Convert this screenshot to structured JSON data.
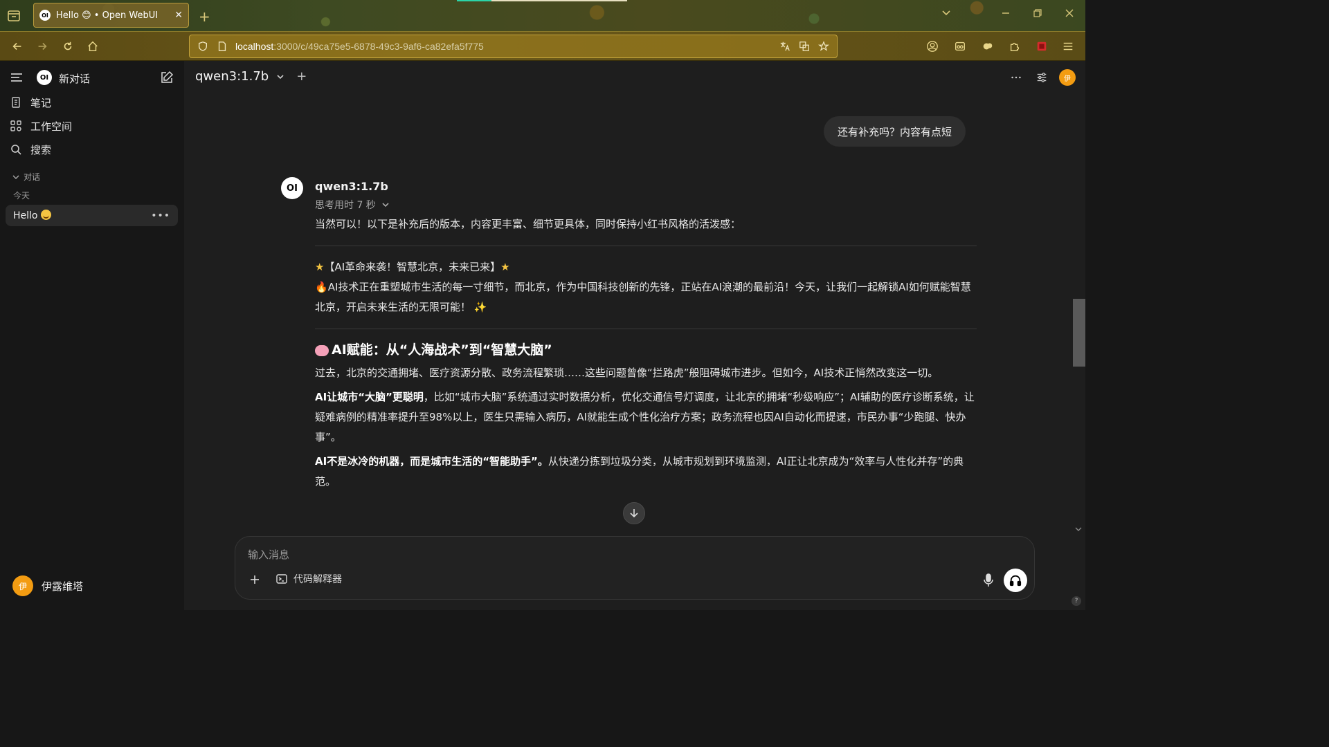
{
  "browser": {
    "tab_title": "Hello 😊 • Open WebUI",
    "tab_close": "✕",
    "new_tab": "+",
    "url_host": "localhost",
    "url_path": ":3000/c/49ca75e5-6878-49c3-9af6-ca82efa5f775"
  },
  "sidebar": {
    "new_chat_label": "新对话",
    "nav": [
      {
        "label": "笔记",
        "icon": "notes-icon"
      },
      {
        "label": "工作空间",
        "icon": "workspace-icon"
      },
      {
        "label": "搜索",
        "icon": "search-icon"
      }
    ],
    "section_label": "对话",
    "group_label": "今天",
    "chats": [
      {
        "title": "Hello",
        "more": "•••"
      }
    ],
    "user": {
      "name": "伊露维塔",
      "avatar_initial": "伊"
    }
  },
  "header": {
    "model": "qwen3:1.7b",
    "add": "+",
    "avatar_initial": "伊"
  },
  "conversation": {
    "user_message": "还有补充吗？内容有点短",
    "assistant": {
      "name": "qwen3:1.7b",
      "thinking": "思考用时 7 秒",
      "intro": "当然可以！以下是补充后的版本，内容更丰富、细节更具体，同时保持小红书风格的活泼感：",
      "banner": "【AI革命来袭！智慧北京，未来已来】",
      "lead": "AI技术正在重塑城市生活的每一寸细节，而北京，作为中国科技创新的先锋，正站在AI浪潮的最前沿！今天，让我们一起解锁AI如何赋能智慧北京，开启未来生活的无限可能！",
      "section_title": "AI赋能：从“人海战术”到“智慧大脑”",
      "para1": "过去，北京的交通拥堵、医疗资源分散、政务流程繁琐……这些问题曾像“拦路虎”般阻碍城市进步。但如今，AI技术正悄然改变这一切。",
      "para2_bold": "AI让城市“大脑”更聪明",
      "para2": "，比如“城市大脑”系统通过实时数据分析，优化交通信号灯调度，让北京的拥堵“秒级响应”；AI辅助的医疗诊断系统，让疑难病例的精准率提升至98%以上，医生只需输入病历，AI就能生成个性化治疗方案；政务流程也因AI自动化而提速，市民办事“少跑腿、快办事”。",
      "para3_bold": "AI不是冰冷的机器，而是城市生活的“智能助手”。",
      "para3": "从快递分拣到垃圾分类，从城市规划到环境监测，AI正让北京成为“效率与人性化并存”的典范。"
    }
  },
  "input": {
    "placeholder": "输入消息",
    "code_interpreter": "代码解释器"
  },
  "colors": {
    "accent": "#f39c12",
    "sidebar_bg": "#171717",
    "main_bg": "#1e1e1e"
  }
}
